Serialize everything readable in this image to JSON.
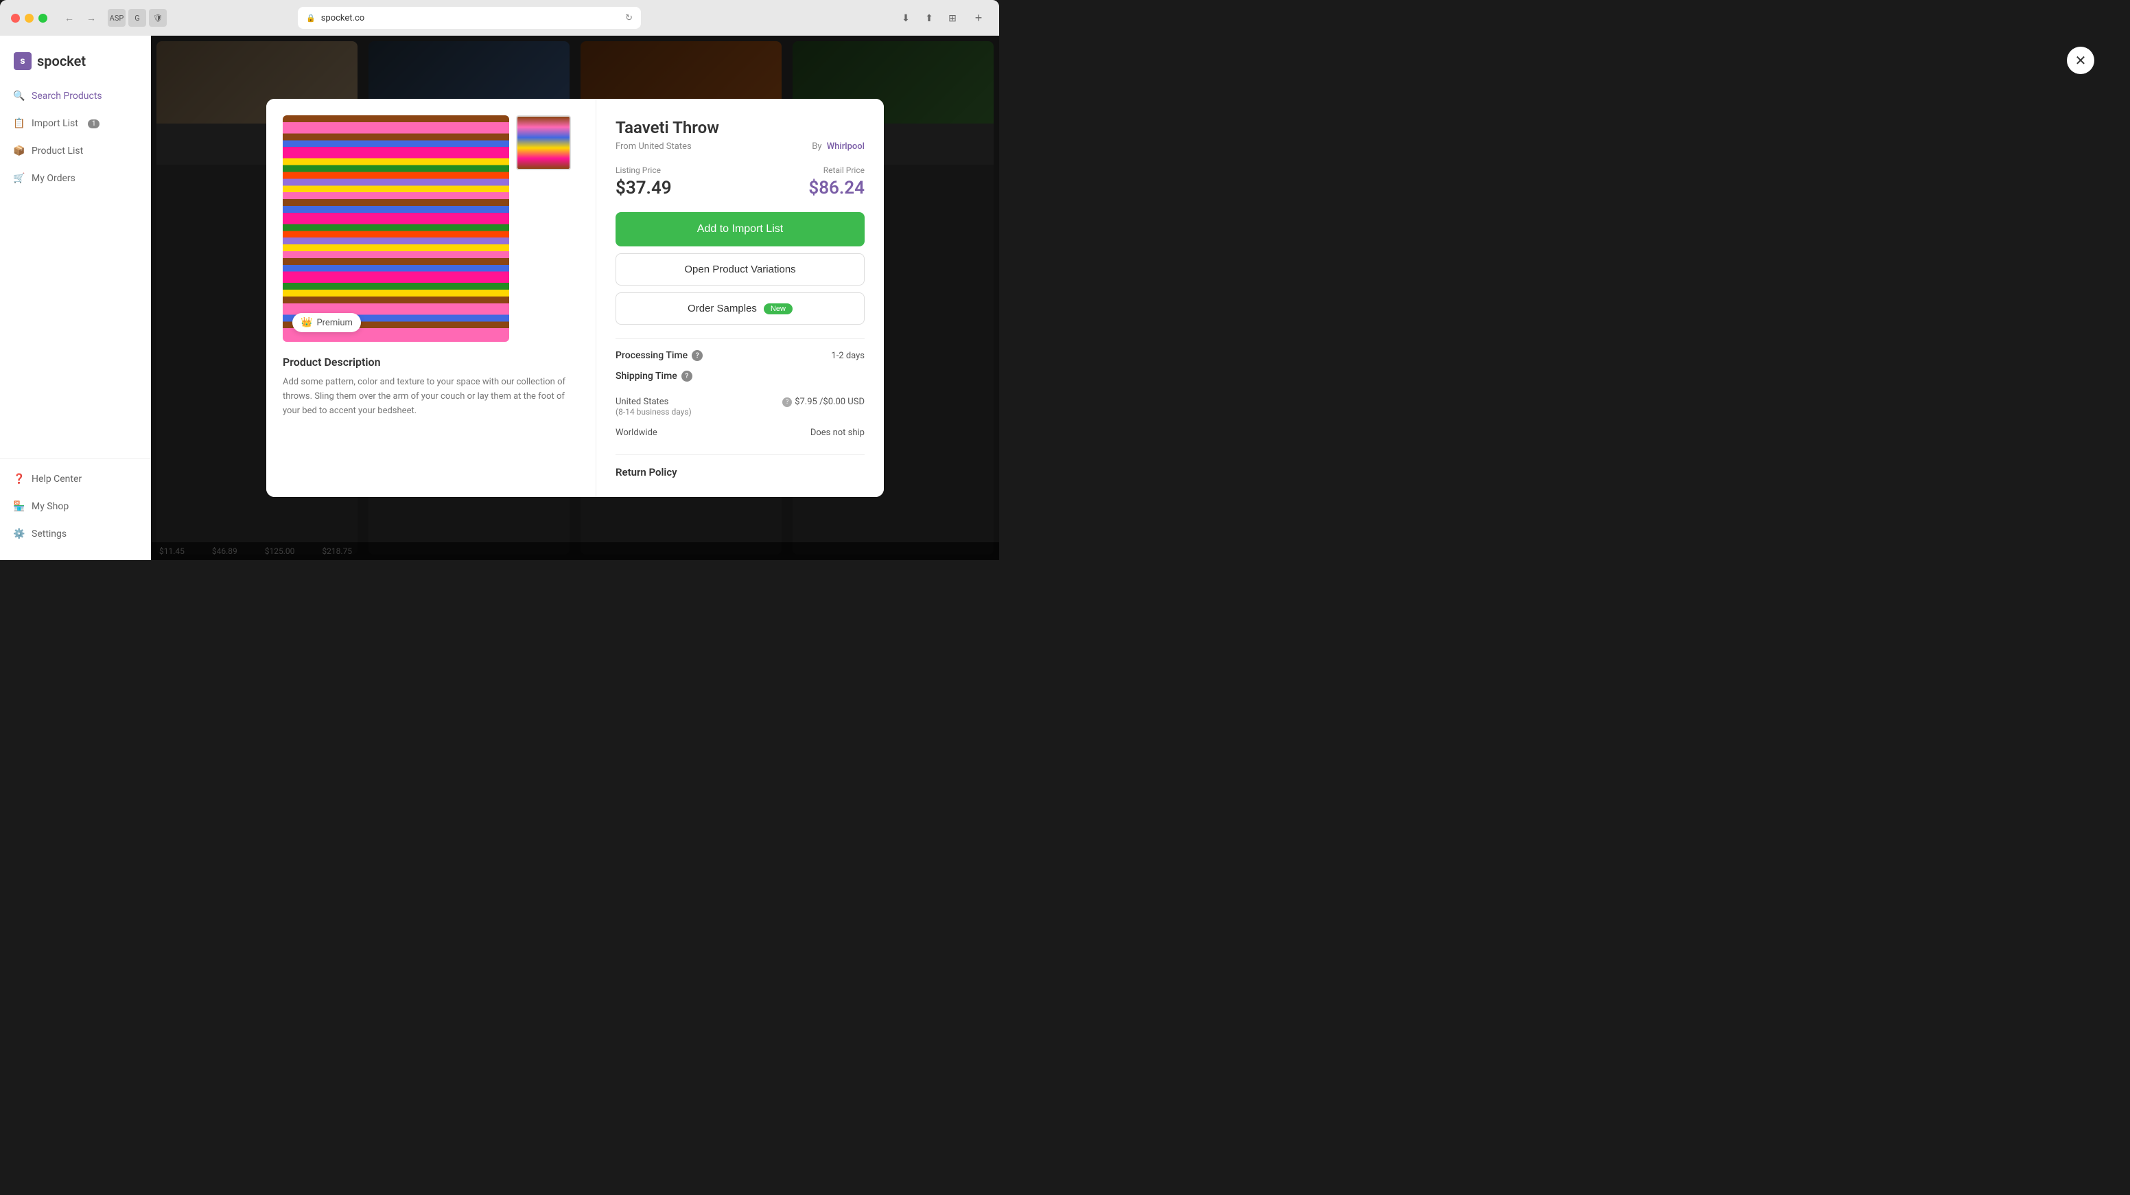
{
  "browser": {
    "url": "spocket.co",
    "back_label": "←",
    "forward_label": "→",
    "reload_label": "↻",
    "add_tab_label": "+"
  },
  "sidebar": {
    "logo_text": "spocket",
    "items": [
      {
        "id": "search-products",
        "label": "Search Products",
        "icon": "🔍"
      },
      {
        "id": "import-list",
        "label": "Import List",
        "icon": "📋",
        "badge": "1"
      },
      {
        "id": "product-list",
        "label": "Product List",
        "icon": "📦"
      },
      {
        "id": "my-orders",
        "label": "My Orders",
        "icon": "🛒"
      }
    ],
    "bottom_items": [
      {
        "id": "help-center",
        "label": "Help Center",
        "icon": "❓"
      },
      {
        "id": "my-shop",
        "label": "My Shop",
        "icon": "🏪"
      },
      {
        "id": "settings",
        "label": "Settings",
        "icon": "⚙️"
      }
    ]
  },
  "modal": {
    "product_title": "Taaveti Throw",
    "product_origin": "From United States",
    "by_label": "By",
    "supplier": "Whirlpool",
    "listing_price_label": "Listing Price",
    "retail_price_label": "Retail Price",
    "listing_price": "$37.49",
    "retail_price": "$86.24",
    "add_to_import_label": "Add to Import List",
    "open_variations_label": "Open Product Variations",
    "order_samples_label": "Order Samples",
    "new_badge": "New",
    "processing_time_label": "Processing Time",
    "processing_time_value": "1-2 days",
    "shipping_time_label": "Shipping Time",
    "us_region": "United States",
    "us_region_sub": "(8-14 business days)",
    "us_shipping_cost": "$7.95 /$0.00 USD",
    "worldwide_label": "Worldwide",
    "worldwide_shipping": "Does not ship",
    "return_policy_label": "Return Policy",
    "premium_badge": "Premium",
    "product_desc_title": "Product Description",
    "product_desc_text": "Add some pattern, color and texture to your space with our collection of throws. Sling them over the arm of your couch or lay them at the foot of your bed to accent your bedsheet."
  },
  "bottom_prices": [
    "$11.45",
    "$46.89",
    "$125.00",
    "$218.75"
  ]
}
